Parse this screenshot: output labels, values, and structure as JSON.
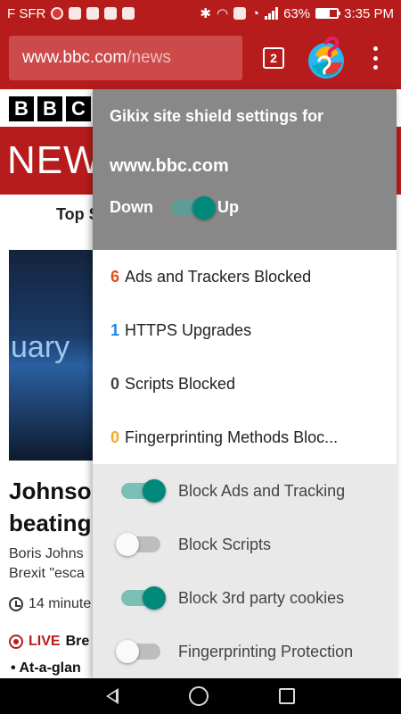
{
  "status_bar": {
    "carrier": "F SFR",
    "battery": "63%",
    "battery_level": 0.63,
    "time": "3:35 PM",
    "icons": [
      "notification-icon",
      "bluetooth-icon",
      "headphones-icon",
      "nfc-icon",
      "wifi-icon",
      "signal-icon",
      "battery-icon"
    ]
  },
  "toolbar": {
    "url_host": "www.bbc.com",
    "url_path": "/news",
    "tab_count": "2",
    "extension_icon": "gikix-logo-icon",
    "menu_icon": "overflow-menu-icon"
  },
  "page": {
    "bbc_letters": [
      "B",
      "B",
      "C"
    ],
    "news_banner": "NEWS",
    "top_stories": "Top S",
    "hero_word": "uary",
    "headline_line1": "Johnso",
    "headline_line2": "beating",
    "summary_line1": "Boris Johns",
    "summary_line2": "Brexit \"esca",
    "time_text": "14 minute",
    "live_label": "LIVE",
    "live_text": "Bre",
    "bullet_text": "At-a-glan"
  },
  "popup": {
    "title": "Gikix site shield settings for",
    "domain": "www.bbc.com",
    "down_label": "Down",
    "up_label": "Up",
    "updown_on": true,
    "stats": [
      {
        "count": "6",
        "label": "Ads and Trackers Blocked",
        "color": "#e64a19"
      },
      {
        "count": "1",
        "label": "HTTPS Upgrades",
        "color": "#1e88e5"
      },
      {
        "count": "0",
        "label": "Scripts Blocked",
        "color": "#424242"
      },
      {
        "count": "0",
        "label": "Fingerprinting Methods Bloc...",
        "color": "#f9a825"
      }
    ],
    "toggles": [
      {
        "label": "Block Ads and Tracking",
        "on": true
      },
      {
        "label": "Block Scripts",
        "on": false
      },
      {
        "label": "Block 3rd party cookies",
        "on": true
      },
      {
        "label": "Fingerprinting Protection",
        "on": false
      }
    ]
  },
  "colors": {
    "brand_red": "#b71c1c",
    "toggle_on": "#00897b",
    "popup_header": "#888888"
  },
  "nav_bar": {
    "icons": [
      "back-icon",
      "home-icon",
      "recent-apps-icon"
    ]
  }
}
